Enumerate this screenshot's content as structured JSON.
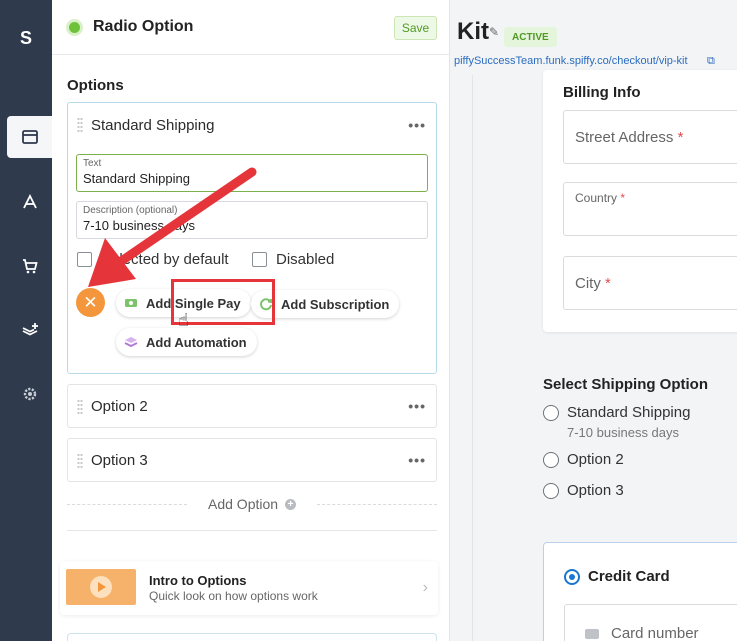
{
  "rail": {
    "logo": "S",
    "items": [
      {
        "icon": "layout-icon",
        "active": true
      },
      {
        "icon": "brush-icon"
      },
      {
        "icon": "cart-icon"
      },
      {
        "icon": "layers-plus-icon"
      },
      {
        "icon": "gear-icon"
      }
    ]
  },
  "panel": {
    "title": "Radio Option",
    "save_label": "Save",
    "section_title": "Options",
    "options": [
      {
        "label": "Standard Shipping",
        "text_label": "Text",
        "text_value": "Standard Shipping",
        "desc_label": "Description (optional)",
        "desc_value": "7-10 business days",
        "selected_default_label": "Selected by default",
        "disabled_label": "Disabled",
        "add_single_pay": "Add Single Pay",
        "add_subscription": "Add Subscription",
        "add_automation": "Add Automation"
      },
      {
        "label": "Option 2"
      },
      {
        "label": "Option 3"
      }
    ],
    "add_option_label": "Add Option",
    "intro": {
      "title": "Intro to Options",
      "subtitle": "Quick look on how options work"
    }
  },
  "preview": {
    "title_fragment": "Kit",
    "status_badge": "ACTIVE",
    "url": "piffySuccessTeam.funk.spiffy.co/checkout/vip-kit",
    "billing": {
      "title": "Billing Info",
      "street_placeholder": "Street Address",
      "country_placeholder": "Country",
      "city_placeholder": "City",
      "required_mark": "*"
    },
    "shipping": {
      "title": "Select Shipping Option",
      "options": [
        {
          "label": "Standard Shipping",
          "sub": "7-10 business days"
        },
        {
          "label": "Option 2"
        },
        {
          "label": "Option 3"
        }
      ]
    },
    "payment": {
      "method_label": "Credit Card",
      "card_placeholder": "Card number"
    }
  },
  "colors": {
    "rail_bg": "#2f3a4c",
    "accent_green": "#6ec23a",
    "remove_orange": "#f4963b",
    "highlight_red": "#e5353a",
    "link_blue": "#2a6cc0",
    "radio_blue": "#1976d2"
  }
}
